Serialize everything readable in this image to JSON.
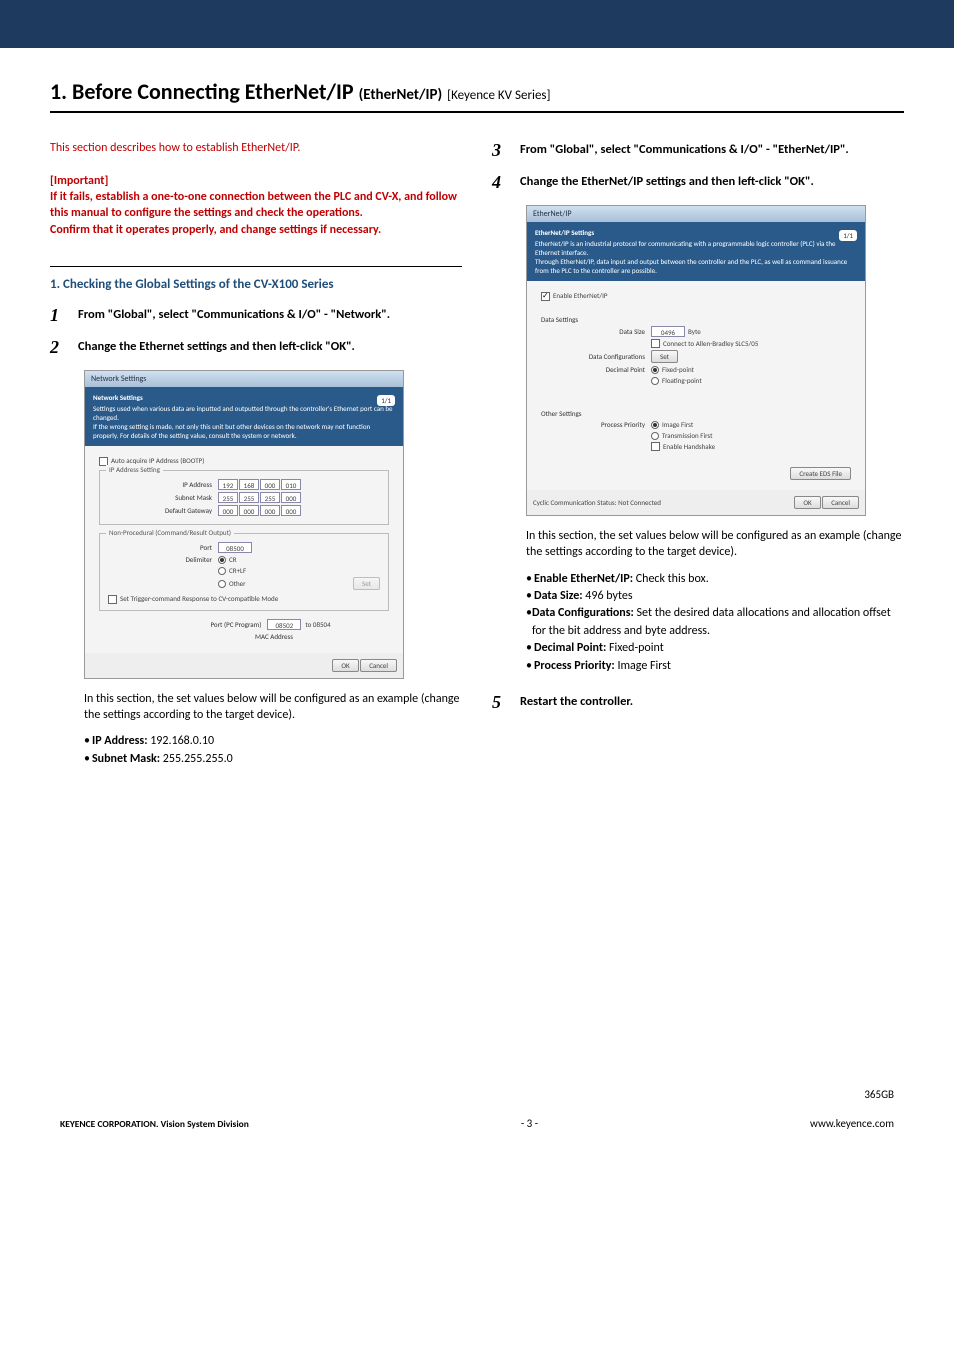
{
  "title_main": "1. Before Connecting EtherNet/IP",
  "title_sub1": "(EtherNet/IP)",
  "title_sub2": "[Keyence KV Series]",
  "intro": "This section describes how to establish EtherNet/IP.",
  "important_label": "[Important]",
  "important_body": "If it fails, establish a one-to-one connection between the PLC and CV-X, and follow this manual to configure the settings and check the operations.\nConfirm that it operates properly, and change settings if necessary.",
  "section1_heading": "1. Checking the Global Settings of the CV-X100 Series",
  "steps": {
    "s1": "From \"Global\", select \"Communications & I/O\" - \"Network\".",
    "s2": "Change the Ethernet settings and then left-click \"OK\".",
    "s3": "From \"Global\", select \"Communications & I/O\" - \"EtherNet/IP\".",
    "s4": "Change the EtherNet/IP settings and then left-click \"OK\".",
    "s5": "Restart the controller."
  },
  "shot1": {
    "title": "Network Settings",
    "blue_heading": "Network Settings",
    "blue_text": "Settings used when various data are inputted and outputted through the controller's Ethernet port can be changed.\nIf the wrong setting is made, not only this unit but other devices on the network may not function properly. For details of the setting value, consult the system or network.",
    "pager": "1/1",
    "auto_acquire": "Auto acquire IP Address (BOOTP)",
    "grp_ip": "IP Address Setting",
    "ip_label": "IP Address",
    "ip": [
      "192",
      "168",
      "000",
      "010"
    ],
    "mask_label": "Subnet Mask",
    "mask": [
      "255",
      "255",
      "255",
      "000"
    ],
    "gw_label": "Default Gateway",
    "gw": [
      "000",
      "000",
      "000",
      "000"
    ],
    "grp_np": "Non-Procedural (Command/Result Output)",
    "port_label": "Port",
    "port": "08500",
    "delim_label": "Delimiter",
    "delim_opts": [
      "CR",
      "CR+LF",
      "Other"
    ],
    "set_btn": "Set",
    "trigger_chk": "Set Trigger-command Response to CV-compatible Mode",
    "pcport_label": "Port (PC Program)",
    "pcport_from": "08502",
    "pcport_to": "to 08504",
    "mac_label": "MAC Address",
    "ok": "OK",
    "cancel": "Cancel"
  },
  "config_para_1": "In this section, the set values below will be configured as an example (change the settings according to the target device).",
  "bullets1": {
    "b1_label": "IP Address:",
    "b1_val": " 192.168.0.10",
    "b2_label": "Subnet Mask:",
    "b2_val": " 255.255.255.0"
  },
  "shot2": {
    "title": "EtherNet/IP",
    "blue_heading": "EtherNet/IP Settings",
    "blue_text": "EtherNet/IP is an industrial protocol for communicating with a programmable logic controller (PLC) via the Ethernet interface.\nThrough EtherNet/IP, data input and output between the controller and the PLC, as well as command issuance from the PLC to the controller are possible.",
    "pager": "1/1",
    "enable": "Enable EtherNet/IP",
    "grp_data": "Data Settings",
    "datasize_label": "Data Size",
    "datasize_val": "0496",
    "datasize_unit": "Byte",
    "connect_ab": "Connect to Allen-Bradley SLC5/05",
    "dataconf_label": "Data Configurations",
    "set_btn": "Set",
    "decimal_label": "Decimal Point",
    "decimal_opts": [
      "Fixed-point",
      "Floating-point"
    ],
    "grp_other": "Other Settings",
    "priority_label": "Process Priority",
    "priority_opts": [
      "Image First",
      "Transmission First"
    ],
    "handshake": "Enable Handshake",
    "create_eds": "Create EDS File",
    "cyclic": "Cyclic Communication Status: Not Connected",
    "ok": "OK",
    "cancel": "Cancel"
  },
  "config_para_2": "In this section, the set values below will be configured as an example (change the settings according to the target device).",
  "bullets2": {
    "b1_label": "Enable EtherNet/IP:",
    "b1_val": " Check this box.",
    "b2_label": "Data Size:",
    "b2_val": " 496 bytes",
    "b3_label": "Data Configurations:",
    "b3_val": " Set the desired data allocations and allocation offset for the bit address and byte address.",
    "b4_label": "Decimal Point:",
    "b4_val": " Fixed-point",
    "b5_label": "Process Priority:",
    "b5_val": " Image First"
  },
  "footer": {
    "left": "KEYENCE CORPORATION. Vision System Division",
    "center": "- 3 -",
    "code": "365GB",
    "url": "www.keyence.com"
  }
}
